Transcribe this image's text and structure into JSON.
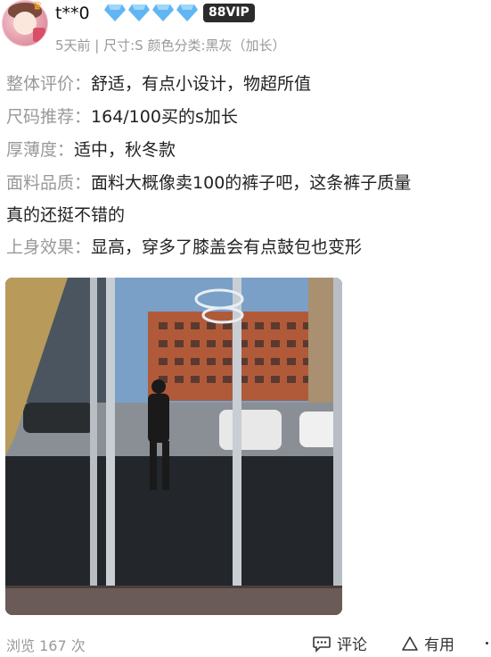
{
  "user": {
    "name": "t**0",
    "vip_badge": "88VIP",
    "diamond_count": 4,
    "diamond_color": "#5fb6f2"
  },
  "review": {
    "meta": "5天前 | 尺寸:S 颜色分类:黑灰（加长）",
    "lines": [
      {
        "label": "整体评价：",
        "text": "舒适，有点小设计，物超所值"
      },
      {
        "label": "尺码推荐：",
        "text": "164/100买的s加长"
      },
      {
        "label": "厚薄度：",
        "text": "适中，秋冬款"
      },
      {
        "label": "面料品质：",
        "text": "面料大概像卖100的裤子吧，这条裤子质量"
      },
      {
        "label": "",
        "text": "真的还挺不错的"
      },
      {
        "label": "上身效果：",
        "text": "显高，穿多了膝盖会有点鼓包也变形"
      }
    ]
  },
  "footer": {
    "views": "浏览 167 次",
    "comment_label": "评论",
    "useful_label": "有用"
  },
  "colors": {
    "label_gray": "#999999",
    "text_dark": "#222222",
    "vip_bg": "#2b2b2b"
  }
}
